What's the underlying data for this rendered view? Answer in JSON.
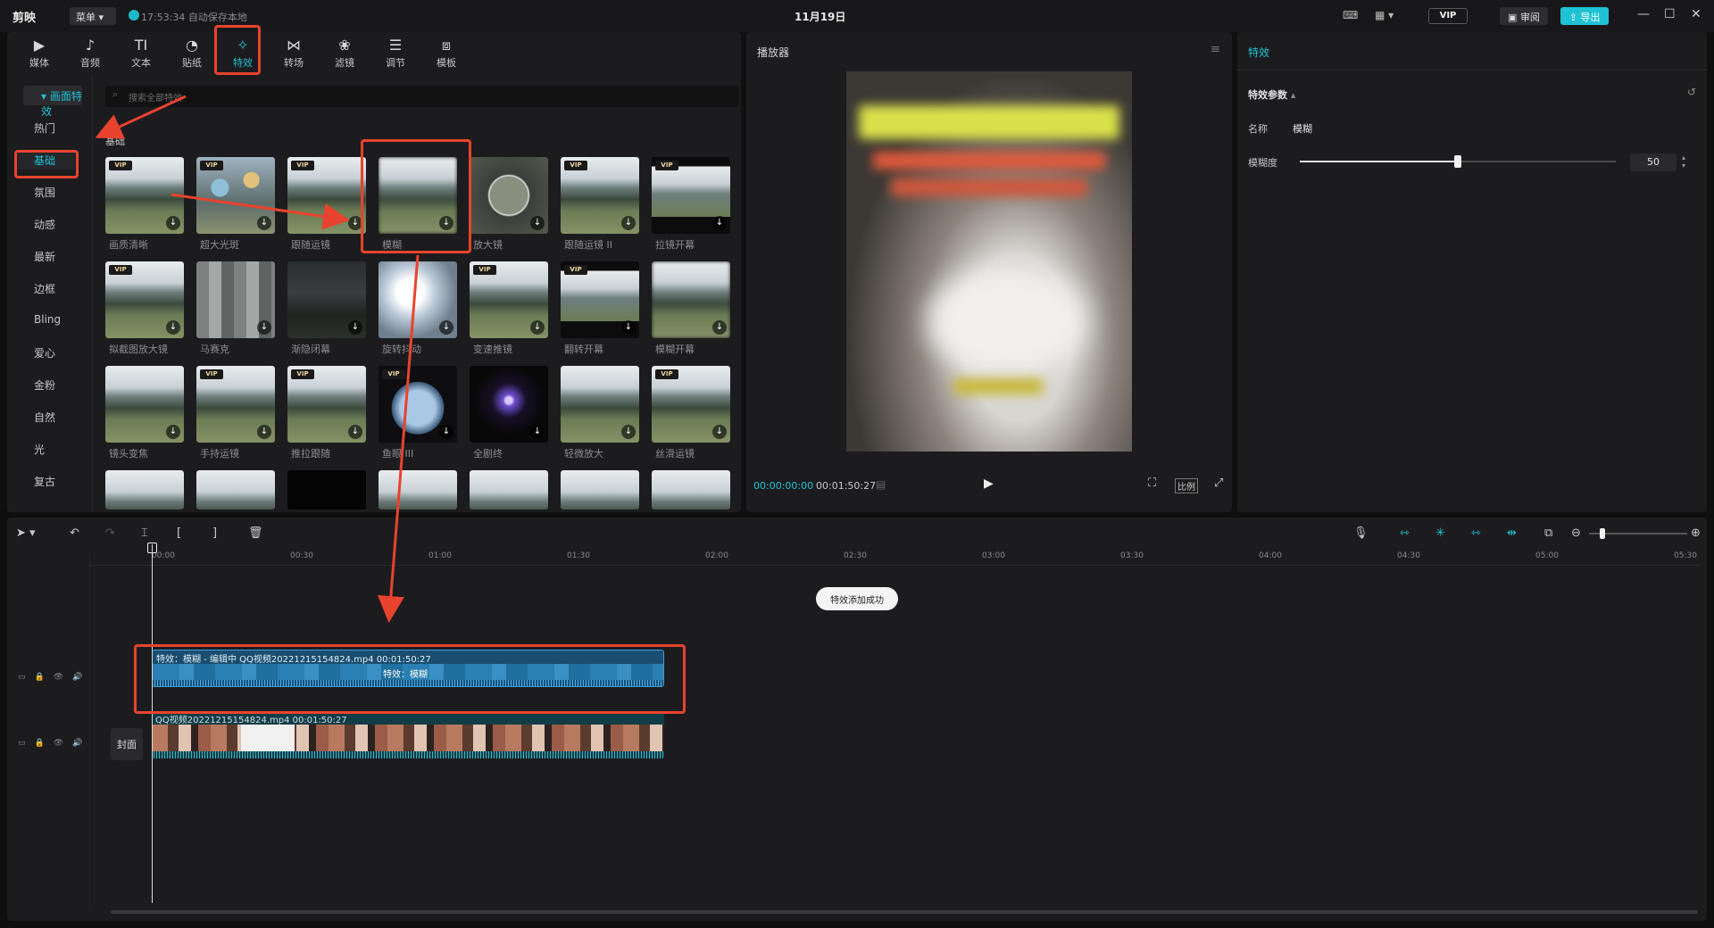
{
  "titlebar": {
    "app_name": "剪映",
    "menu_label": "菜单",
    "save_status": "17:53:34 自动保存本地",
    "date_title": "11月19日",
    "vip_label": "VIP",
    "review_label": "审阅",
    "export_label": "导出"
  },
  "toolbar": {
    "tabs": [
      {
        "label": "媒体",
        "icon": "media-icon"
      },
      {
        "label": "音频",
        "icon": "audio-icon"
      },
      {
        "label": "文本",
        "icon": "text-icon"
      },
      {
        "label": "贴纸",
        "icon": "sticker-icon"
      },
      {
        "label": "特效",
        "icon": "effects-icon",
        "active": true
      },
      {
        "label": "转场",
        "icon": "transition-icon"
      },
      {
        "label": "滤镜",
        "icon": "filter-icon"
      },
      {
        "label": "调节",
        "icon": "adjust-icon"
      },
      {
        "label": "模板",
        "icon": "template-icon"
      }
    ]
  },
  "sidebar": {
    "group_label": "画面特效",
    "items": [
      "热门",
      "基础",
      "氛围",
      "动感",
      "最新",
      "边框",
      "Bling",
      "爱心",
      "金粉",
      "自然",
      "光",
      "复古"
    ],
    "selected": "基础"
  },
  "search": {
    "placeholder": "搜索全部特效"
  },
  "section_label": "基础",
  "effects": [
    {
      "name": "画质清晰",
      "vip": true
    },
    {
      "name": "超大光斑",
      "vip": true
    },
    {
      "name": "跟随运镜",
      "vip": true
    },
    {
      "name": "模糊",
      "vip": false
    },
    {
      "name": "放大镜",
      "vip": false
    },
    {
      "name": "跟随运镜 II",
      "vip": true
    },
    {
      "name": "拉镜开幕",
      "vip": true
    },
    {
      "name": "拟截图放大镜",
      "vip": true
    },
    {
      "name": "马赛克",
      "vip": false
    },
    {
      "name": "渐隐闭幕",
      "vip": false
    },
    {
      "name": "旋转抖动",
      "vip": false
    },
    {
      "name": "变速推镜",
      "vip": true
    },
    {
      "name": "翻转开幕",
      "vip": true
    },
    {
      "name": "模糊开幕",
      "vip": false
    },
    {
      "name": "镜头变焦",
      "vip": false
    },
    {
      "name": "手持运镜",
      "vip": true
    },
    {
      "name": "推拉跟随",
      "vip": true
    },
    {
      "name": "鱼眼 III",
      "vip": true
    },
    {
      "name": "全剧终",
      "vip": false
    },
    {
      "name": "轻微放大",
      "vip": false
    },
    {
      "name": "丝滑运镜",
      "vip": true
    }
  ],
  "player": {
    "title": "播放器",
    "current_time": "00:00:00:00",
    "total_time": "00:01:50:27",
    "ratio_label": "比例"
  },
  "props": {
    "title": "特效",
    "section": "特效参数",
    "name_label": "名称",
    "name_value": "模糊",
    "blur_label": "模糊度",
    "blur_value": "50",
    "blur_level_percent": 50
  },
  "timeline": {
    "ticks": [
      "00:00",
      "00:30",
      "01:00",
      "01:30",
      "02:00",
      "02:30",
      "03:00",
      "03:30",
      "04:00",
      "04:30",
      "05:00",
      "05:30"
    ],
    "toast": "特效添加成功",
    "fx_clip_header": "特效：模糊 - 编辑中  QQ视频20221215154824.mp4  00:01:50:27",
    "fx_clip_label": "特效：模糊",
    "video_clip_header": "QQ视频20221215154824.mp4  00:01:50:27",
    "cover_label": "封面"
  }
}
